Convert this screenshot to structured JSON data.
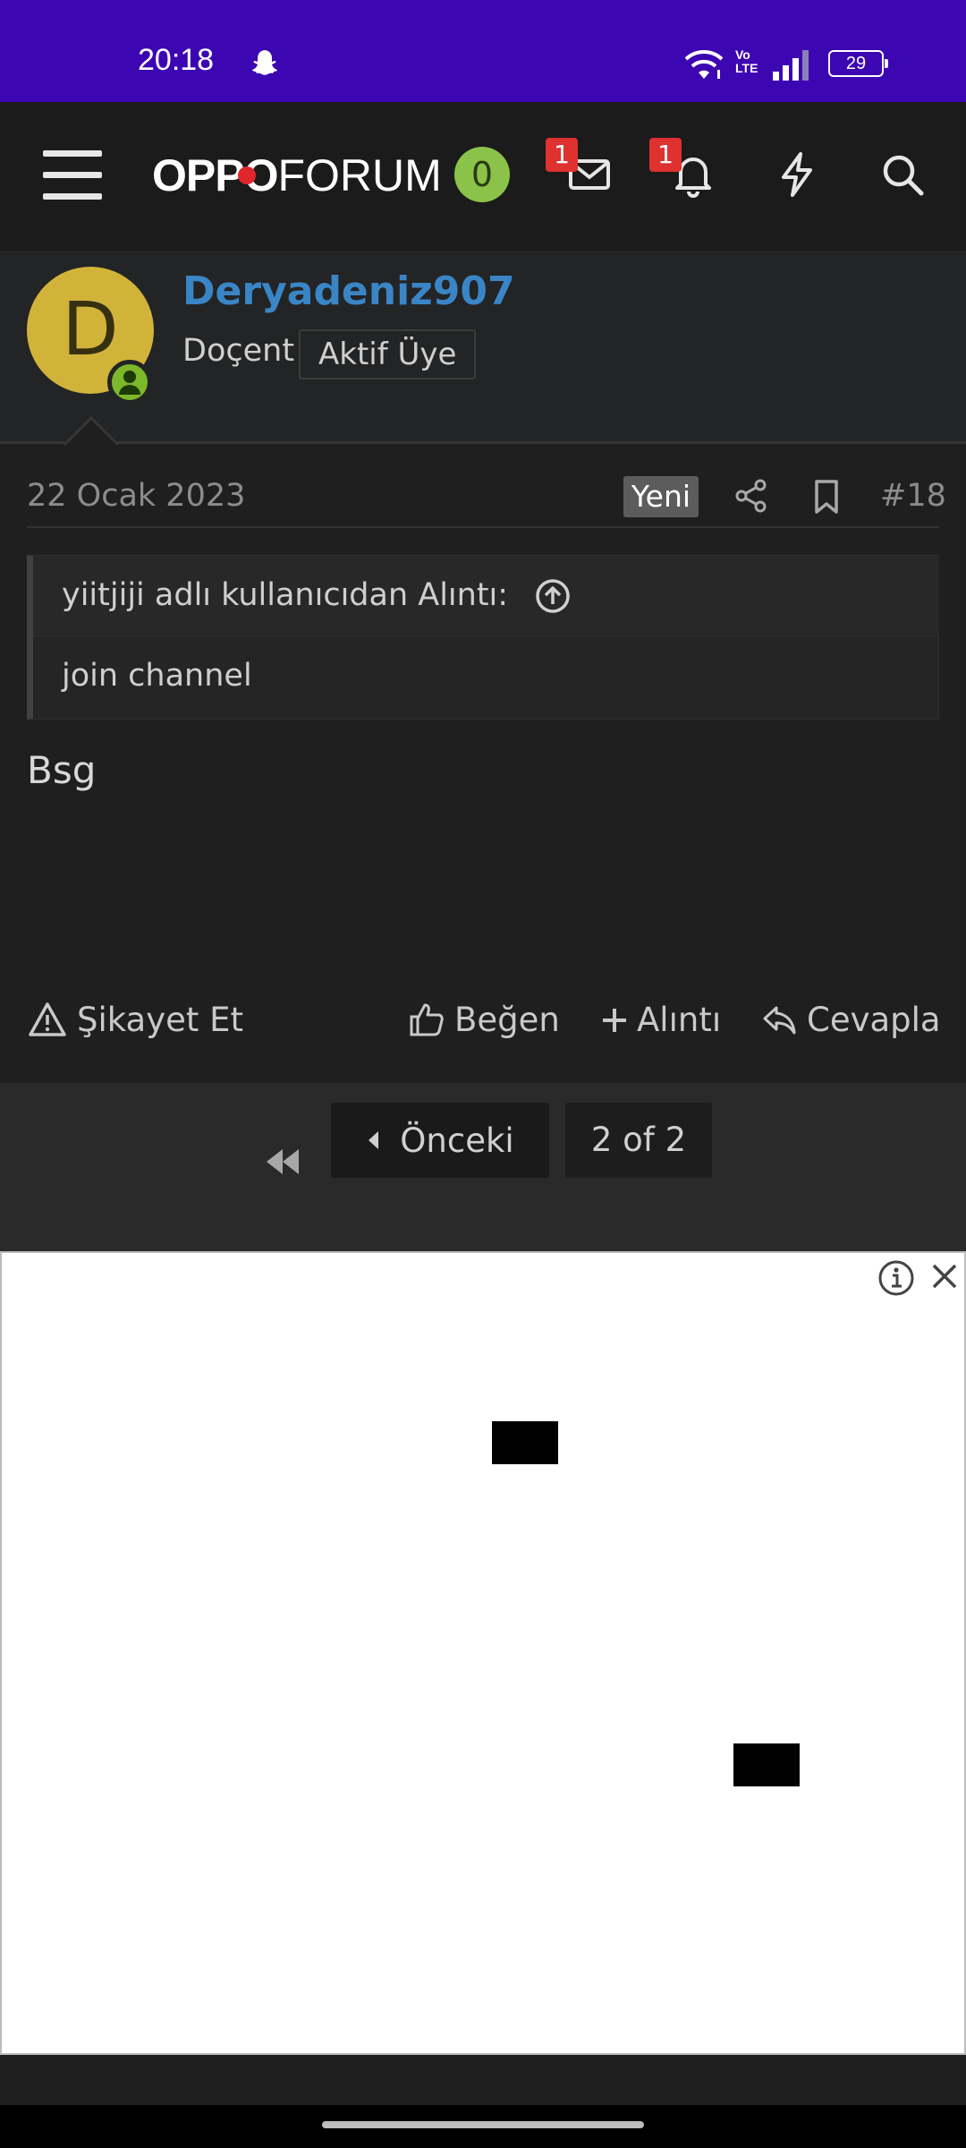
{
  "status_bar": {
    "time": "20:18",
    "volte": "Vo LTE",
    "battery": "29",
    "icons": [
      "snapchat-icon",
      "wifi-icon",
      "volte-icon",
      "signal-icon",
      "battery-icon"
    ]
  },
  "header": {
    "logo_bold": "OPPO",
    "logo_light": "FORUM",
    "points": "0",
    "messages_badge": "1",
    "alerts_badge": "1",
    "icons": [
      "menu-icon",
      "mail-icon",
      "bell-icon",
      "lightning-icon",
      "search-icon"
    ],
    "colors": {
      "logo_dot": "#e0262b",
      "points_bg": "#8bc34a",
      "badge": "#e03131"
    }
  },
  "post": {
    "avatar_letter": "D",
    "username": "Deryadeniz907",
    "user_title": "Doçent",
    "user_rank": "Aktif Üye",
    "date": "22 Ocak 2023",
    "new_tag": "Yeni",
    "post_number": "#18",
    "quote": {
      "attribution": "yiitjiji adlı kullanıcıdan Alıntı:",
      "text": "join channel"
    },
    "message": "Bsg",
    "actions": {
      "report": "Şikayet Et",
      "like": "Beğen",
      "quote": "Alıntı",
      "reply": "Cevapla"
    },
    "colors": {
      "username": "#3a85c6",
      "avatar": "#d2b33a",
      "online": "#7cb82a"
    }
  },
  "pagination": {
    "previous": "Önceki",
    "current": "2 of 2"
  },
  "status_bar_color": "#3d06b3"
}
